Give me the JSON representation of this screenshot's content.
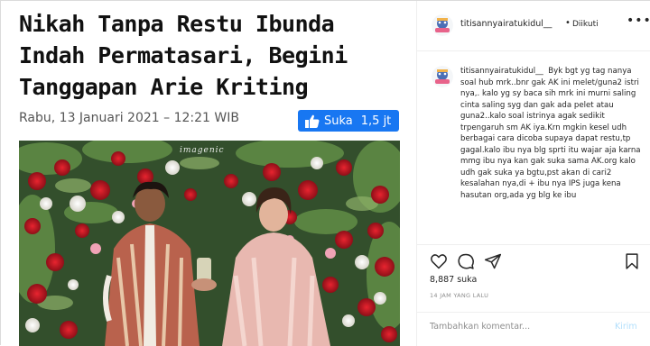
{
  "article": {
    "headline": "Nikah Tanpa Restu Ibunda Indah Permatasari, Begini Tanggapan Arie Kriting",
    "date": "Rabu, 13 Januari 2021 – 12:21 WIB",
    "like_label": "Suka",
    "like_count": "1,5 jt",
    "photo_watermark": "imagenic",
    "brand_color": "#1877f2"
  },
  "post": {
    "username": "titisannyairatukidul__",
    "separator": "•",
    "follow_label": "Diikuti",
    "more_icon": "more-horizontal-icon"
  },
  "comment": {
    "username": "titisannyairatukidul__",
    "text": "Byk bgt yg tag nanya soal hub mrk..bnr gak AK ini melet/guna2 istri nya,. kalo yg sy baca sih mrk ini murni saling cinta saling syg dan gak ada pelet atau guna2..kalo soal istrinya agak sedikit trpengaruh sm AK iya.Krn mgkin kesel udh berbagai cara dicoba supaya dapat restu,tp gagal.kalo ibu nya blg sprti itu wajar aja karna mmg ibu nya kan gak suka sama AK.org kalo udh gak suka ya bgtu,pst akan di cari2 kesalahan nya,di + ibu nya IPS juga kena hasutan org,ada yg blg ke ibu"
  },
  "actions": {
    "likes": "8,887 suka",
    "time": "14 JAM YANG LALU",
    "comment_placeholder": "Tambahkan komentar...",
    "post_label": "Kirim",
    "icons": [
      "heart-icon",
      "comment-icon",
      "share-icon",
      "bookmark-icon"
    ]
  }
}
